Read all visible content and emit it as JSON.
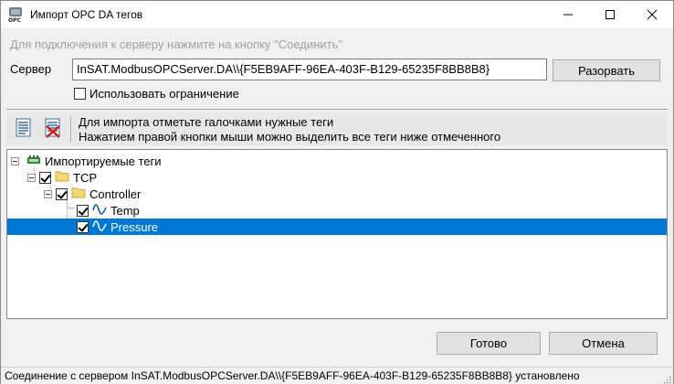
{
  "window": {
    "title": "Импорт OPC DA тегов",
    "icon": "opc-app-icon"
  },
  "hint": "Для подключения к серверу нажмите на кнопку \"Соединить\"",
  "server": {
    "label": "Сервер",
    "value": "InSAT.ModbusOPCServer.DA\\\\{F5EB9AFF-96EA-403F-B129-65235F8BB8B8}",
    "disconnect_label": "Разорвать"
  },
  "limit": {
    "label": "Использовать ограничение",
    "checked": false
  },
  "toolbar": {
    "line1": "Для импорта отметьте галочками нужные теги",
    "line2": "Нажатием правой кнопки мыши можно выделить все теги ниже отмеченного"
  },
  "tree": {
    "root": {
      "label": "Импортируемые теги"
    },
    "tcp": {
      "label": "TCP",
      "checked": true
    },
    "controller": {
      "label": "Controller",
      "checked": true
    },
    "temp": {
      "label": "Temp",
      "checked": true
    },
    "pressure": {
      "label": "Pressure",
      "checked": true,
      "selected": true
    }
  },
  "buttons": {
    "ok": "Готово",
    "cancel": "Отмена"
  },
  "status": "Соединение с сервером InSAT.ModbusOPCServer.DA\\\\{F5EB9AFF-96EA-403F-B129-65235F8BB8B8} установлено",
  "colors": {
    "selection": "#0078d7",
    "folder": "#f5d66f",
    "signal": "#0050c0"
  }
}
